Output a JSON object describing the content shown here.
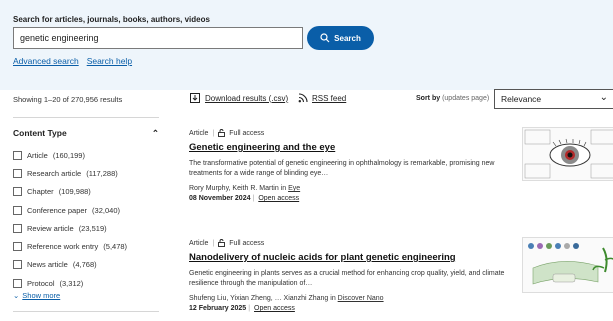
{
  "search": {
    "label": "Search for articles, journals, books, authors, videos",
    "value": "genetic engineering",
    "button_label": "Search",
    "advanced_link": "Advanced search",
    "help_link": "Search help"
  },
  "results_bar": {
    "count_text": "Showing 1–20 of 270,956 results",
    "download_label": "Download results (.csv)",
    "rss_label": "RSS feed",
    "sort_by_label": "Sort by",
    "sort_note": "(updates page)",
    "sort_value": "Relevance"
  },
  "facets": {
    "title": "Content Type",
    "items": [
      {
        "label": "Article",
        "count": "(160,199)"
      },
      {
        "label": "Research article",
        "count": "(117,288)"
      },
      {
        "label": "Chapter",
        "count": "(109,988)"
      },
      {
        "label": "Conference paper",
        "count": "(32,040)"
      },
      {
        "label": "Review article",
        "count": "(23,519)"
      },
      {
        "label": "Reference work entry",
        "count": "(5,478)"
      },
      {
        "label": "News article",
        "count": "(4,768)"
      },
      {
        "label": "Protocol",
        "count": "(3,312)"
      }
    ],
    "show_more": "Show more"
  },
  "results": [
    {
      "type": "Article",
      "access": "Full access",
      "title": "Genetic engineering and the eye",
      "description": "The transformative potential of genetic engineering in ophthalmology is remarkable, promising new treatments for a wide range of blinding eye…",
      "authors": "Rory Murphy, Keith R. Martin in ",
      "journal": "Eye",
      "date": "08 November 2024",
      "open_access": "Open access"
    },
    {
      "type": "Article",
      "access": "Full access",
      "title": "Nanodelivery of nucleic acids for plant genetic engineering",
      "description": "Genetic engineering in plants serves as a crucial method for enhancing crop quality, yield, and climate resilience through the manipulation of…",
      "authors": "Shufeng Liu, Yixian Zheng, … Xianzhi Zhang in ",
      "journal": "Discover Nano",
      "date": "12 February 2025",
      "open_access": "Open access"
    }
  ],
  "colors": {
    "banner_bg": "#eef5fb",
    "accent": "#0a5ea8"
  }
}
